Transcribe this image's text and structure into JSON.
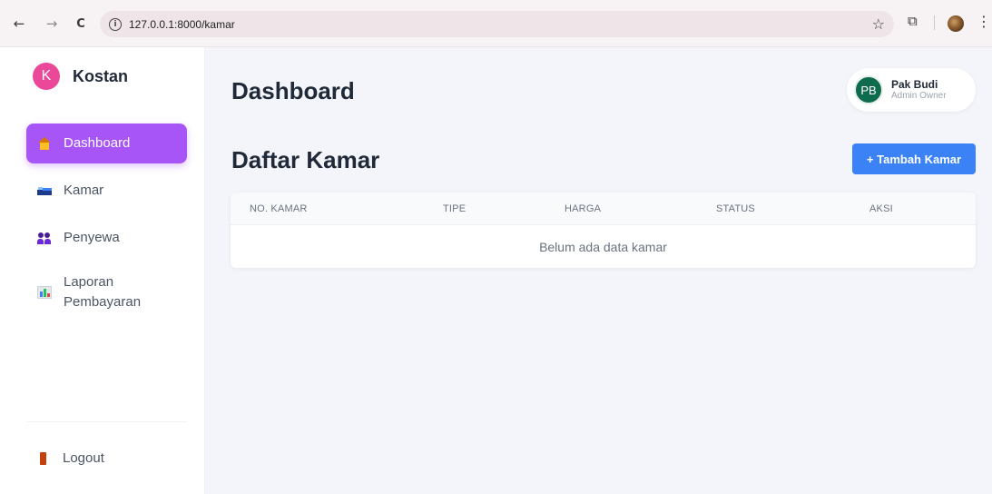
{
  "browser": {
    "back_glyph": "←",
    "forward_glyph": "→",
    "reload_glyph": "C",
    "info_glyph": "i",
    "url": "127.0.0.1:8000/kamar",
    "star_glyph": "☆",
    "extensions_glyph": "⧉",
    "menu_glyph": "⋮"
  },
  "sidebar": {
    "brand": {
      "logo_letter": "K",
      "name": "Kostan",
      "logo_color": "#ec4899"
    },
    "items": [
      {
        "label": "Dashboard",
        "icon": "house-icon",
        "active": true
      },
      {
        "label": "Kamar",
        "icon": "bed-icon",
        "active": false
      },
      {
        "label": "Penyewa",
        "icon": "people-icon",
        "active": false
      },
      {
        "label": "Laporan Pembayaran",
        "icon": "chart-icon",
        "active": false
      }
    ],
    "logout_label": "Logout",
    "accent_color": "#a855f7"
  },
  "header": {
    "title": "Dashboard",
    "user": {
      "initials": "PB",
      "name": "Pak Budi",
      "role": "Admin Owner",
      "avatar_color": "#0f6b4e"
    }
  },
  "main": {
    "section_title": "Daftar Kamar",
    "add_button_label": "+ Tambah Kamar",
    "button_color": "#3b82f6",
    "table": {
      "columns": [
        "NO. KAMAR",
        "TIPE",
        "HARGA",
        "STATUS",
        "AKSI"
      ],
      "rows": [],
      "empty_message": "Belum ada data kamar"
    }
  }
}
